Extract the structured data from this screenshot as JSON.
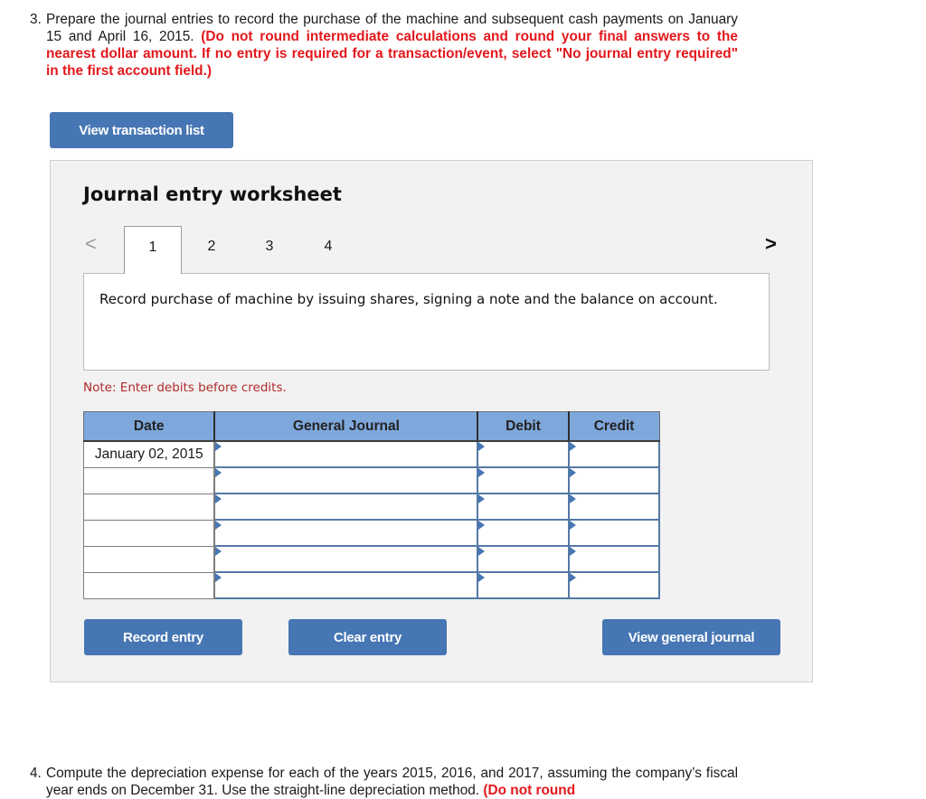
{
  "question3": {
    "number": "3.",
    "text": "Prepare the journal entries to record the purchase of the machine and subsequent cash payments on January 15 and April 16, 2015.",
    "instruction": "(Do not round intermediate calculations and round your final answers to the nearest dollar amount. If no entry is required for a transaction/event, select \"No journal entry required\" in the first account field.)"
  },
  "buttons": {
    "view_transaction_list": "View transaction list",
    "record_entry": "Record entry",
    "clear_entry": "Clear entry",
    "view_general_journal": "View general journal"
  },
  "worksheet": {
    "title": "Journal entry worksheet",
    "nav_prev": "<",
    "nav_next": ">",
    "tabs": [
      {
        "label": "1",
        "active": true
      },
      {
        "label": "2",
        "active": false
      },
      {
        "label": "3",
        "active": false
      },
      {
        "label": "4",
        "active": false
      }
    ],
    "description": "Record purchase of machine by issuing shares, signing a note and the balance on account.",
    "note": "Note: Enter debits before credits.",
    "table": {
      "headers": [
        "Date",
        "General Journal",
        "Debit",
        "Credit"
      ],
      "rows": [
        {
          "date": "January 02, 2015",
          "account": "",
          "debit": "",
          "credit": ""
        },
        {
          "date": "",
          "account": "",
          "debit": "",
          "credit": ""
        },
        {
          "date": "",
          "account": "",
          "debit": "",
          "credit": ""
        },
        {
          "date": "",
          "account": "",
          "debit": "",
          "credit": ""
        },
        {
          "date": "",
          "account": "",
          "debit": "",
          "credit": ""
        },
        {
          "date": "",
          "account": "",
          "debit": "",
          "credit": ""
        }
      ]
    }
  },
  "question4": {
    "number": "4.",
    "text": "Compute the depreciation expense for each of the years 2015, 2016, and 2017, assuming the company’s fiscal year ends on December 31. Use the straight-line depreciation method.",
    "instruction": "(Do not round"
  },
  "colors": {
    "button_blue": "#4676b3",
    "header_blue": "#7ea8dc",
    "instruction_red": "#e3181c",
    "note_red": "#b02a2a",
    "panel_bg": "#f2f2f2"
  }
}
